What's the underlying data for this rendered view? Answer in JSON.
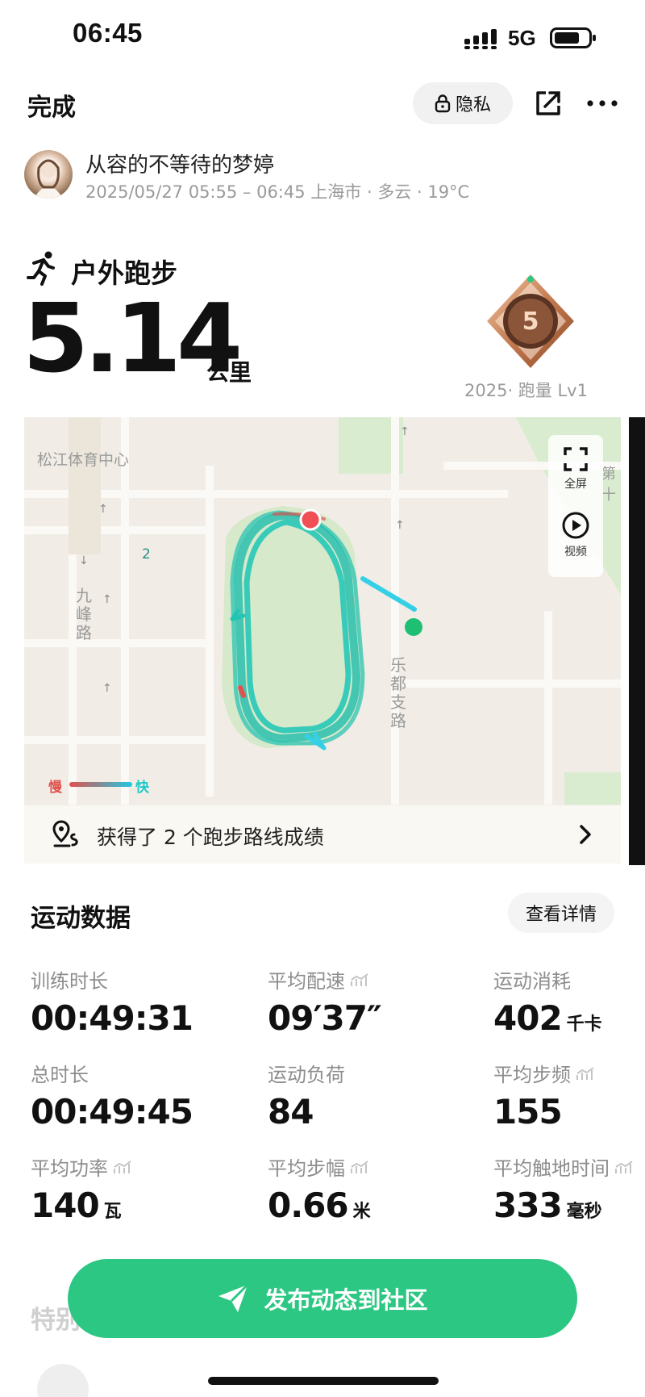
{
  "status_bar": {
    "time": "06:45",
    "network": "5G"
  },
  "header": {
    "done_label": "完成",
    "privacy_label": "隐私"
  },
  "user": {
    "name": "从容的不等待的梦婷",
    "meta": "2025/05/27 05:55 – 06:45 上海市 · 多云 · 19°C"
  },
  "activity": {
    "type": "户外跑步",
    "distance": "5.14",
    "distance_unit": "公里"
  },
  "medal": {
    "caption": "2025· 跑量 Lv1",
    "number": "5"
  },
  "map": {
    "labels": {
      "place": "松江体育中心",
      "road_left": "九峰路",
      "road_right": "乐都支路",
      "number": "2",
      "edge": "第十"
    },
    "controls": {
      "fullscreen": "全屏",
      "video": "视频"
    },
    "legend": {
      "slow": "慢",
      "fast": "快"
    },
    "route_banner": "获得了 2 个跑步路线成绩"
  },
  "stats": {
    "title": "运动数据",
    "details_label": "查看详情",
    "items": [
      {
        "label": "训练时长",
        "value": "00:49:31",
        "unit": ""
      },
      {
        "label": "平均配速",
        "value": "09′37″",
        "unit": ""
      },
      {
        "label": "运动消耗",
        "value": "402",
        "unit": "千卡"
      },
      {
        "label": "总时长",
        "value": "00:49:45",
        "unit": ""
      },
      {
        "label": "运动负荷",
        "value": "84",
        "unit": ""
      },
      {
        "label": "平均步频",
        "value": "155",
        "unit": ""
      },
      {
        "label": "平均功率",
        "value": "140",
        "unit": "瓦"
      },
      {
        "label": "平均步幅",
        "value": "0.66",
        "unit": "米"
      },
      {
        "label": "平均触地时间",
        "value": "333",
        "unit": "毫秒"
      }
    ]
  },
  "bottom": {
    "section_partial": "特别",
    "publish_label": "发布动态到社区"
  },
  "colors": {
    "accent_green": "#2cc782",
    "route_fast": "#20c9c9",
    "route_slow": "#e0524e",
    "map_bg": "#f1ede6",
    "park_green": "#d9ecd0"
  },
  "icons": [
    "signal-icon",
    "battery-icon",
    "lock-icon",
    "share-icon",
    "more-icon",
    "running-icon",
    "medal-icon",
    "fullscreen-icon",
    "play-icon",
    "route-icon",
    "chevron-right-icon",
    "trend-icon",
    "send-icon"
  ]
}
